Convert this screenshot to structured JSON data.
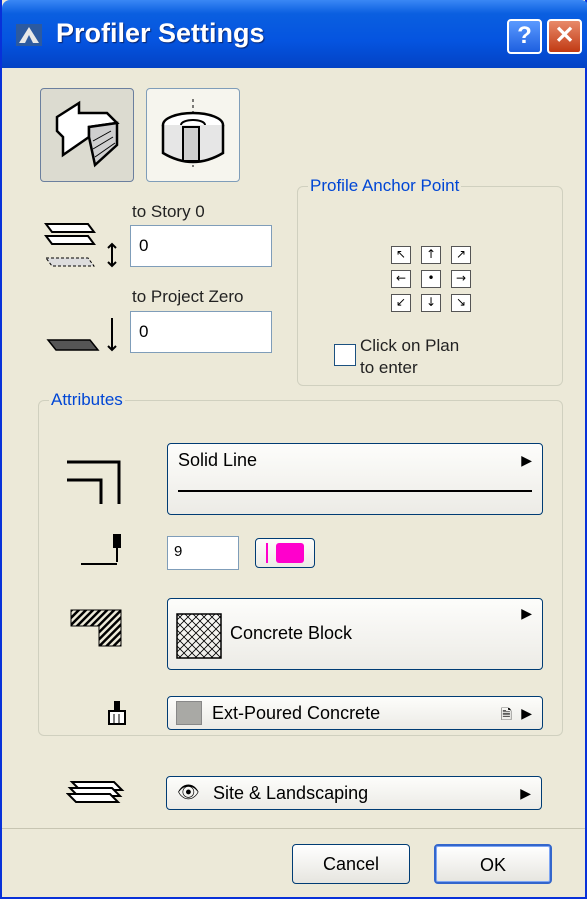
{
  "window": {
    "title": "Profiler Settings",
    "help_label": "?",
    "close_label": "✕"
  },
  "mode_buttons": [
    {
      "name": "wall-profile-icon",
      "pressed": true
    },
    {
      "name": "column-profile-icon",
      "pressed": false
    }
  ],
  "elevation": {
    "story_label": "to Story 0",
    "story_value": "0",
    "project_zero_label": "to Project Zero",
    "project_zero_value": "0"
  },
  "anchor": {
    "legend": "Profile Anchor Point",
    "cells": [
      "↖",
      "↑",
      "↗",
      "←",
      "•",
      "→",
      "↙",
      "↓",
      "↘"
    ],
    "click_label_line1": "Click on Plan",
    "click_label_line2": "to enter",
    "click_checked": false
  },
  "attributes": {
    "legend": "Attributes",
    "line_type": "Solid Line",
    "pen_number": "9",
    "pen_color": "#ff00cc",
    "fill": "Concrete Block",
    "material": "Ext-Poured Concrete",
    "material_color": "#a9a9a5"
  },
  "layer": {
    "name": "Site & Landscaping"
  },
  "footer": {
    "cancel_label": "Cancel",
    "ok_label": "OK"
  }
}
